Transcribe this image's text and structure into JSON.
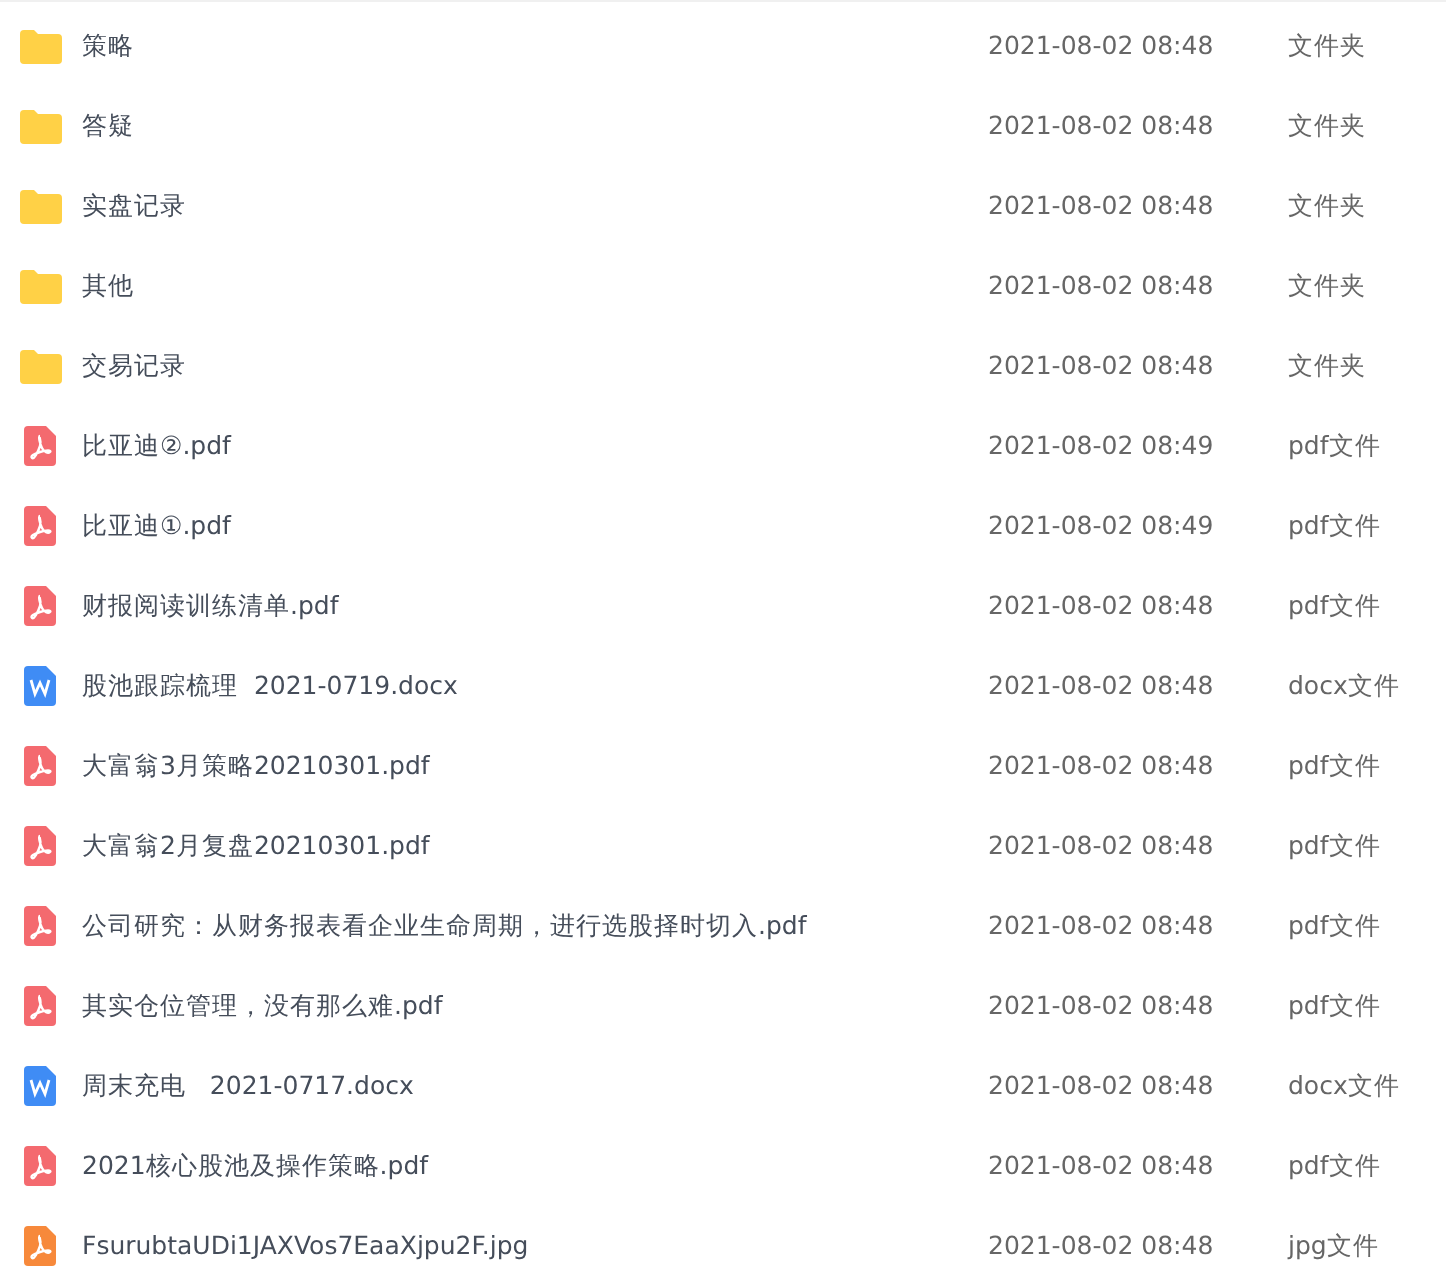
{
  "files": [
    {
      "kind": "folder",
      "name": "策略",
      "modified": "2021-08-02 08:48",
      "type": "文件夹"
    },
    {
      "kind": "folder",
      "name": "答疑",
      "modified": "2021-08-02 08:48",
      "type": "文件夹"
    },
    {
      "kind": "folder",
      "name": "实盘记录",
      "modified": "2021-08-02 08:48",
      "type": "文件夹"
    },
    {
      "kind": "folder",
      "name": "其他",
      "modified": "2021-08-02 08:48",
      "type": "文件夹"
    },
    {
      "kind": "folder",
      "name": "交易记录",
      "modified": "2021-08-02 08:48",
      "type": "文件夹"
    },
    {
      "kind": "pdf",
      "name": "比亚迪②.pdf",
      "modified": "2021-08-02 08:49",
      "type": "pdf文件"
    },
    {
      "kind": "pdf",
      "name": "比亚迪①.pdf",
      "modified": "2021-08-02 08:49",
      "type": "pdf文件"
    },
    {
      "kind": "pdf",
      "name": "财报阅读训练清单.pdf",
      "modified": "2021-08-02 08:48",
      "type": "pdf文件"
    },
    {
      "kind": "docx",
      "name": "股池跟踪梳理  2021-0719.docx",
      "modified": "2021-08-02 08:48",
      "type": "docx文件"
    },
    {
      "kind": "pdf",
      "name": "大富翁3月策略20210301.pdf",
      "modified": "2021-08-02 08:48",
      "type": "pdf文件"
    },
    {
      "kind": "pdf",
      "name": "大富翁2月复盘20210301.pdf",
      "modified": "2021-08-02 08:48",
      "type": "pdf文件"
    },
    {
      "kind": "pdf",
      "name": "公司研究：从财务报表看企业生命周期，进行选股择时切入.pdf",
      "modified": "2021-08-02 08:48",
      "type": "pdf文件"
    },
    {
      "kind": "pdf",
      "name": "其实仓位管理，没有那么难.pdf",
      "modified": "2021-08-02 08:48",
      "type": "pdf文件"
    },
    {
      "kind": "docx",
      "name": "周末充电   2021-0717.docx",
      "modified": "2021-08-02 08:48",
      "type": "docx文件"
    },
    {
      "kind": "pdf",
      "name": "2021核心股池及操作策略.pdf",
      "modified": "2021-08-02 08:48",
      "type": "pdf文件"
    },
    {
      "kind": "jpg",
      "name": "FsurubtaUDi1JAXVos7EaaXjpu2F.jpg",
      "modified": "2021-08-02 08:48",
      "type": "jpg文件"
    }
  ]
}
